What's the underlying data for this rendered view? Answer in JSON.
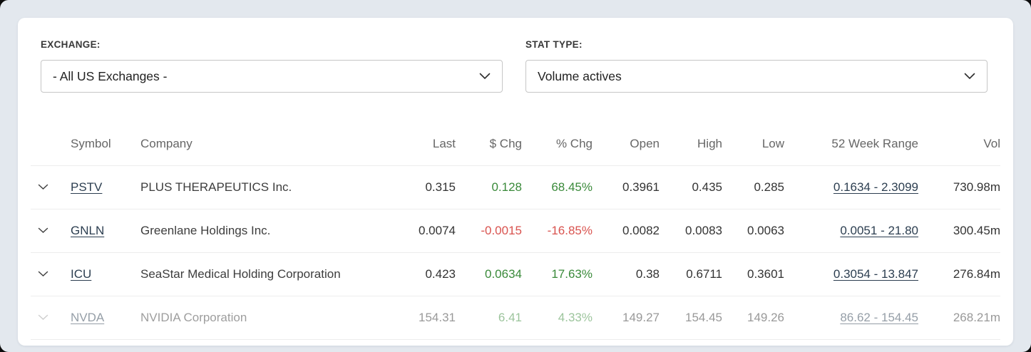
{
  "filters": {
    "exchange": {
      "label": "EXCHANGE:",
      "value": "- All US Exchanges -"
    },
    "stat_type": {
      "label": "STAT TYPE:",
      "value": "Volume actives"
    }
  },
  "table": {
    "columns": [
      "Symbol",
      "Company",
      "Last",
      "$ Chg",
      "% Chg",
      "Open",
      "High",
      "Low",
      "52 Week Range",
      "Vol"
    ],
    "rows": [
      {
        "symbol": "PSTV",
        "company": "PLUS THERAPEUTICS Inc.",
        "last": "0.315",
        "chg": "0.128",
        "pchg": "68.45%",
        "open": "0.3961",
        "high": "0.435",
        "low": "0.285",
        "range": "0.1634 - 2.3099",
        "vol": "730.98m",
        "direction": "up",
        "faded": false
      },
      {
        "symbol": "GNLN",
        "company": "Greenlane Holdings Inc.",
        "last": "0.0074",
        "chg": "-0.0015",
        "pchg": "-16.85%",
        "open": "0.0082",
        "high": "0.0083",
        "low": "0.0063",
        "range": "0.0051 - 21.80",
        "vol": "300.45m",
        "direction": "down",
        "faded": false
      },
      {
        "symbol": "ICU",
        "company": "SeaStar Medical Holding Corporation",
        "last": "0.423",
        "chg": "0.0634",
        "pchg": "17.63%",
        "open": "0.38",
        "high": "0.6711",
        "low": "0.3601",
        "range": "0.3054 - 13.847",
        "vol": "276.84m",
        "direction": "up",
        "faded": false
      },
      {
        "symbol": "NVDA",
        "company": "NVIDIA Corporation",
        "last": "154.31",
        "chg": "6.41",
        "pchg": "4.33%",
        "open": "149.27",
        "high": "154.45",
        "low": "149.26",
        "range": "86.62 - 154.45",
        "vol": "268.21m",
        "direction": "up",
        "faded": true
      }
    ]
  },
  "icons": {
    "row_toggle": "chevron-down-icon",
    "select_arrow": "chevron-down-icon"
  },
  "colors": {
    "positive": "#3a8a3a",
    "negative": "#d9534f",
    "link": "#2c3e50",
    "background": "#e3e8ee"
  }
}
